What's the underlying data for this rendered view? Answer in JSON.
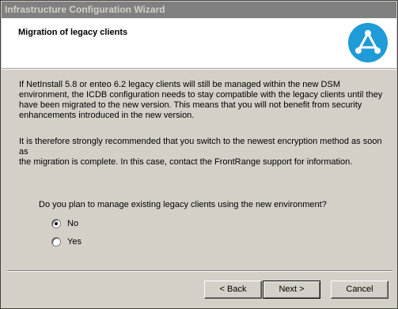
{
  "window": {
    "title": "Infrastructure Configuration Wizard"
  },
  "header": {
    "title": "Migration of legacy clients",
    "logo_icon": "frontrange-logo-icon"
  },
  "body": {
    "paragraph1": "If NetInstall 5.8 or enteo 6.2 legacy clients will still be managed within the new DSM\nenvironment, the ICDB configuration needs to stay compatible with the legacy clients until they\nhave been migrated to the new version. This means that you will not benefit from security\nenhancements introduced in the new version.",
    "paragraph2": "It is therefore strongly recommended that you switch to the newest encryption method as soon as\nthe migration is complete. In this case, contact the FrontRange support for information.",
    "question": "Do you plan to manage existing legacy clients using the new environment?",
    "options": [
      {
        "label": "No",
        "selected": true
      },
      {
        "label": "Yes",
        "selected": false
      }
    ]
  },
  "footer": {
    "back_label": "< Back",
    "next_label": "Next >",
    "cancel_label": "Cancel"
  },
  "colors": {
    "logo_blue": "#1f9bd7",
    "titlebar": "#808080"
  }
}
